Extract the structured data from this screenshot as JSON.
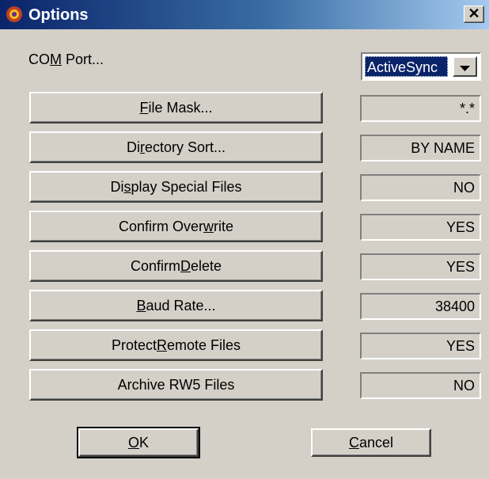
{
  "window": {
    "title": "Options",
    "close_glyph": "✕"
  },
  "com_port": {
    "label_pre": "CO",
    "label_u": "M",
    "label_post": " Port...",
    "value": "ActiveSync"
  },
  "rows": [
    {
      "pre": "",
      "u": "F",
      "post": "ile Mask...",
      "value": "*.*"
    },
    {
      "pre": "Di",
      "u": "r",
      "post": "ectory Sort...",
      "value": "BY NAME"
    },
    {
      "pre": "Di",
      "u": "s",
      "post": "play Special Files",
      "value": "NO"
    },
    {
      "pre": "Confirm Over",
      "u": "w",
      "post": "rite",
      "value": "YES"
    },
    {
      "pre": "Confirm ",
      "u": "D",
      "post": "elete",
      "value": "YES"
    },
    {
      "pre": "",
      "u": "B",
      "post": "aud Rate...",
      "value": "38400"
    },
    {
      "pre": "Protect ",
      "u": "R",
      "post": "emote Files",
      "value": "YES"
    },
    {
      "pre": "Archive RW5 Files",
      "u": "",
      "post": "",
      "value": "NO"
    }
  ],
  "ok": {
    "u": "O",
    "post": "K"
  },
  "cancel": {
    "u": "C",
    "post": "ancel"
  },
  "icons": {
    "app": "options-app-icon",
    "close": "close-icon",
    "dropdown": "chevron-down-icon"
  }
}
